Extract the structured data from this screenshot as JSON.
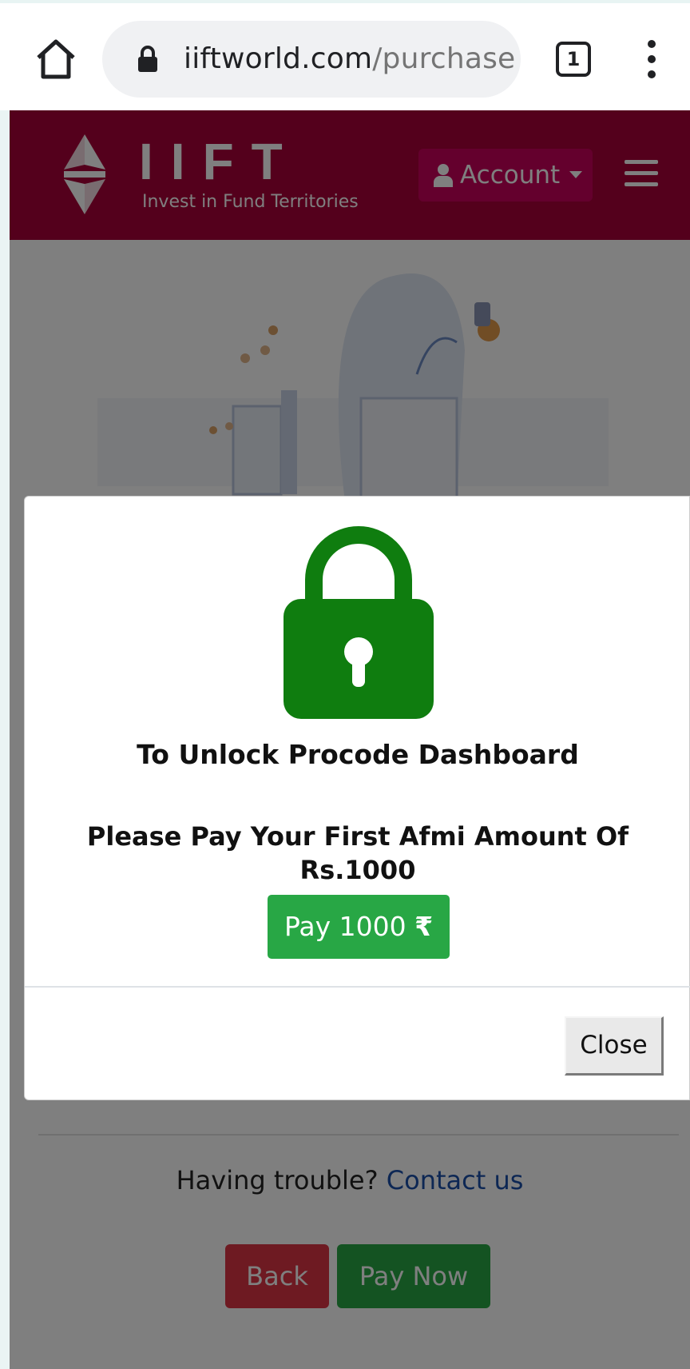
{
  "browser": {
    "url_domain": "iiftworld.com",
    "url_path": "/purchase",
    "tab_count": "1"
  },
  "header": {
    "brand_name": "IIFT",
    "brand_tagline": "Invest in Fund Territories",
    "account_label": "Account",
    "colors": {
      "header_bg": "#a80038",
      "account_bg": "#c8005a"
    }
  },
  "modal": {
    "title": "To Unlock Procode Dashboard",
    "message": "Please Pay Your First Afmi Amount Of Rs.1000",
    "pay_label": "Pay 1000",
    "currency_symbol": "₹",
    "close_label": "Close",
    "colors": {
      "lock": "#0f7d0f",
      "pay_button": "#28a745"
    }
  },
  "footer": {
    "trouble_text": "Having trouble?",
    "contact_link": "Contact us",
    "back_label": "Back",
    "pay_now_label": "Pay Now"
  },
  "icons": [
    "home-icon",
    "lock-icon",
    "tabs-icon",
    "more-vert-icon",
    "person-icon",
    "caret-down-icon",
    "hamburger-menu-icon",
    "padlock-icon",
    "rupee-icon"
  ]
}
